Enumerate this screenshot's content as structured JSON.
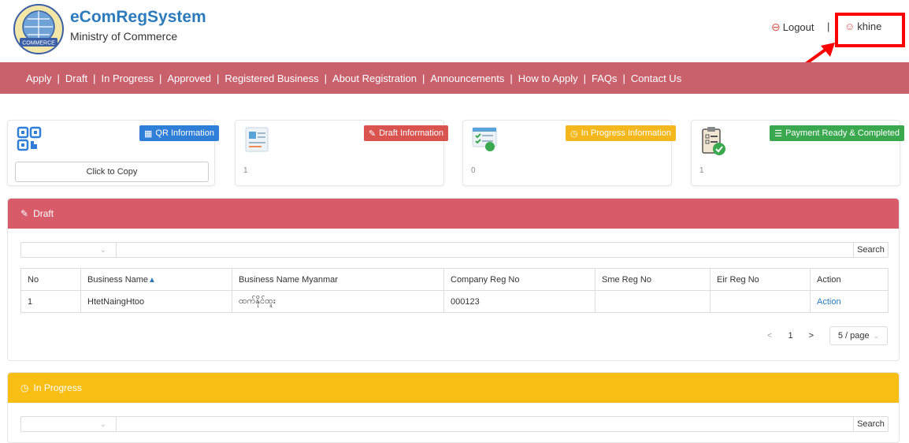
{
  "header": {
    "brand_title": "eComRegSystem",
    "brand_subtitle": "Ministry of Commerce",
    "logo_text": "COMMERCE",
    "logout_label": "Logout",
    "separator": "|",
    "username": "khine"
  },
  "nav": {
    "items": [
      "Apply",
      "Draft",
      "In Progress",
      "Approved",
      "Registered Business",
      "About Registration",
      "Announcements",
      "How to Apply",
      "FAQs",
      "Contact Us"
    ],
    "separator": "|"
  },
  "cards": {
    "qr": {
      "badge": "QR Information",
      "copy_label": "Click to Copy",
      "color": "#2f7fd9"
    },
    "draft": {
      "badge": "Draft Information",
      "count": "1",
      "color": "#d9534f"
    },
    "in_progress": {
      "badge": "In Progress Information",
      "count": "0",
      "color": "#f5b81c"
    },
    "payment": {
      "badge": "Payment Ready & Completed",
      "count": "1",
      "color": "#3aa84e"
    }
  },
  "draft_panel": {
    "title": "Draft",
    "color": "#d75b68",
    "search_label": "Search",
    "columns": [
      "No",
      "Business Name",
      "Business Name Myanmar",
      "Company Reg No",
      "Sme Reg No",
      "Eir Reg No",
      "Action"
    ],
    "rows": [
      {
        "no": "1",
        "business_name": "HtetNaingHtoo",
        "business_name_mm": "ထက်နိုင်ထူး",
        "company_reg_no": "000123",
        "sme_reg_no": "",
        "eir_reg_no": "",
        "action": "Action"
      }
    ],
    "pagination": {
      "prev": "<",
      "page": "1",
      "next": ">",
      "page_size": "5 / page"
    }
  },
  "progress_panel": {
    "title": "In Progress",
    "color": "#f9be14",
    "search_label": "Search"
  }
}
